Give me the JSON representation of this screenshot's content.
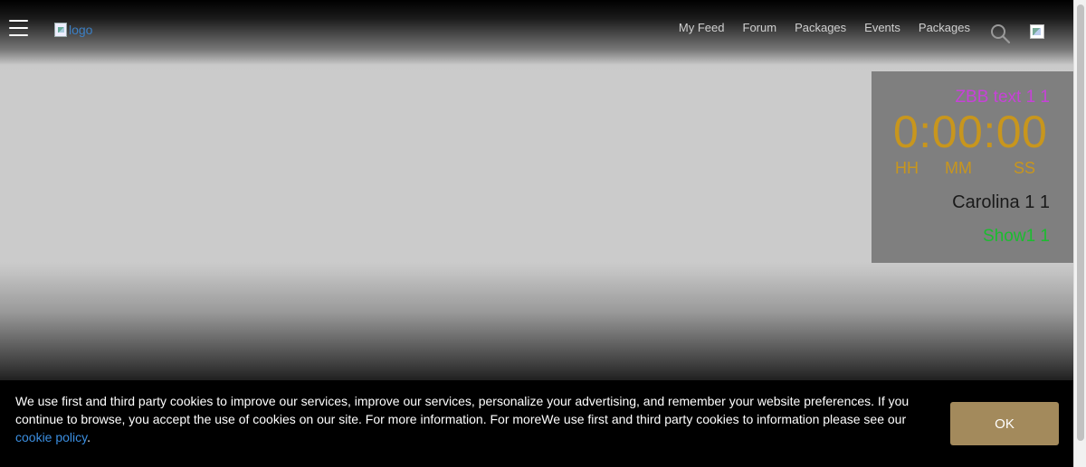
{
  "header": {
    "logo_alt": "logo",
    "nav": [
      "My Feed",
      "Forum",
      "Packages",
      "Events",
      "Packages"
    ]
  },
  "countdown": {
    "title": "ZBB text 1 1",
    "time": "0:00:00",
    "units": {
      "hh": "HH",
      "mm": "MM",
      "ss": "SS"
    },
    "name": "Carolina 1 1",
    "show": "Show1 1"
  },
  "cookie": {
    "text": "We use first and third party cookies to improve our services, improve our services, personalize your advertising, and remember your website preferences. If you continue to browse, you accept the use of cookies on our site. For more information. For moreWe use first and third party cookies to information please see our ",
    "link": "cookie policy",
    "suffix": ".",
    "button": "OK"
  },
  "colors": {
    "title": "#c742d8",
    "time": "#c8961d",
    "show": "#1bbd2f",
    "ok_button": "#a38a5c",
    "link": "#3b8ee0"
  },
  "icons": [
    "hamburger-icon",
    "search-icon",
    "broken-image-icon"
  ]
}
